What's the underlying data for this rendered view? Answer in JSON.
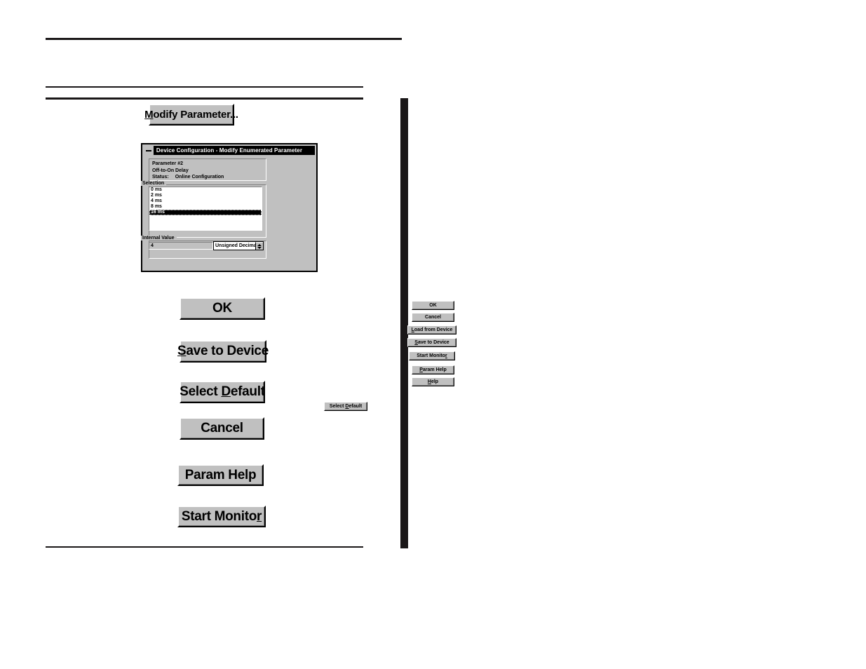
{
  "page": {
    "background": "#ffffff",
    "rules": {
      "top": "horizontal-rule-top",
      "middle_thin": "horizontal-rule-middle-thin",
      "middle_thick": "horizontal-rule-middle-thick",
      "bottom": "horizontal-rule-bottom"
    },
    "sidebar_bar_color": "#1a1718"
  },
  "modify_parameter_button": {
    "label_pre": "M",
    "label_post": "odify Parameter..."
  },
  "dialog": {
    "title": "Device Configuration - Modify Enumerated Parameter",
    "system_box_icon": "minimize-icon",
    "info": {
      "parameter": "Parameter #2",
      "name": "Off-to-On Delay",
      "status_label": "Status:",
      "status_value": "Online Configuration"
    },
    "selection": {
      "legend": "Selection",
      "items": [
        {
          "label": "0 ms",
          "selected": false
        },
        {
          "label": "2 ms",
          "selected": false
        },
        {
          "label": "4 ms",
          "selected": false
        },
        {
          "label": "8 ms",
          "selected": false
        },
        {
          "label": "16 ms",
          "selected": true
        }
      ],
      "selected_value": "16 ms"
    },
    "internal_value": {
      "legend": "Internal Value",
      "value": "4",
      "format_selected": "Unsigned Decimal",
      "format_options": [
        "Unsigned Decimal"
      ]
    },
    "buttons": {
      "ok": "OK",
      "cancel": "Cancel",
      "load_from_device_pre": "L",
      "load_from_device_post": "oad from Device",
      "save_to_device_pre": "S",
      "save_to_device_post": "ave to Device",
      "start_monitor_pre": "Start Monito",
      "start_monitor_post": "r",
      "param_help_pre": "P",
      "param_help_post": "aram Help",
      "help_pre": "H",
      "help_post": "elp",
      "select_default_pre": "Select ",
      "select_default_mid": "D",
      "select_default_post": "efault"
    }
  },
  "callout_buttons": {
    "ok": "OK",
    "save_to_device_pre": "S",
    "save_to_device_post": "ave to Device",
    "select_default_pre": "Select ",
    "select_default_mid": "D",
    "select_default_post": "efault",
    "cancel": "Cancel",
    "param_help": "Param Help",
    "start_monitor_pre": "Start Monito",
    "start_monitor_post": "r"
  }
}
